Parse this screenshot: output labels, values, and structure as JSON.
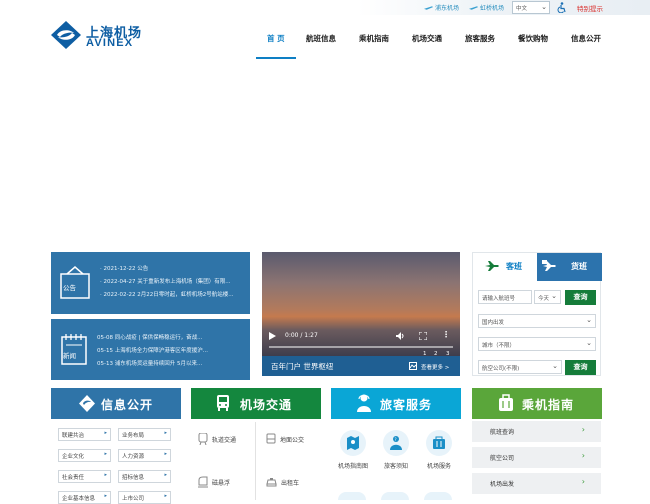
{
  "topbar": {
    "pudong": "浦东机场",
    "hongqiao": "虹桥机场",
    "language": "中文",
    "special": "特别提示"
  },
  "brand": {
    "cn": "上海机场",
    "en": "AVINEX",
    "color": "#0e5ea3"
  },
  "nav": {
    "items": [
      "首 页",
      "航班信息",
      "乘机指南",
      "机场交通",
      "旅客服务",
      "餐饮购物",
      "信息公开"
    ],
    "active_color": "#0e7fc4"
  },
  "notice": {
    "icon_label": "公告",
    "lines": [
      "· 2021-12-22 公告",
      "· 2022-04-27 关于重新发布上海机场（集团）有限...",
      "· 2022-02-22 2月22日零时起，虹桥机场2号航站楼..."
    ]
  },
  "news": {
    "icon_label": "新闻",
    "lines": [
      "05-08 同心战疫 | 保供保畅稳运行，奋战...",
      "05-15 上海机场全力保障沪港客区年度援沪...",
      "05-13 浦东机场货运量持续回升 5月以来..."
    ]
  },
  "video": {
    "time": "0:00 / 1:27",
    "pages": [
      "1",
      "2",
      "3"
    ],
    "caption": "百年门户 世界枢纽",
    "more": "查看更多 >",
    "progress": 0
  },
  "flight": {
    "tab_flight": "客班",
    "tab_cargo": "货班",
    "flight_no_placeholder": "请输入航班号",
    "date": "今天",
    "query1": "查询",
    "direction": "国内出发",
    "city": "城市（不限）",
    "airline": "航空公司(不限)",
    "query2": "查询"
  },
  "categories": {
    "info": "信息公开",
    "transport": "机场交通",
    "service": "旅客服务",
    "guide": "乘机指南"
  },
  "info_dropdowns": [
    "联建共治",
    "业务布局",
    "企业文化",
    "人力资源",
    "社会责任",
    "招标信息",
    "企业基本信息",
    "上市公司"
  ],
  "transport_items": [
    "轨道交通",
    "地面公交",
    "磁悬浮",
    "出租车"
  ],
  "service_items": [
    "机场指南图",
    "旅客须知",
    "机场服务"
  ],
  "guide_items": [
    "航班查询",
    "航空公司",
    "机场出发"
  ]
}
